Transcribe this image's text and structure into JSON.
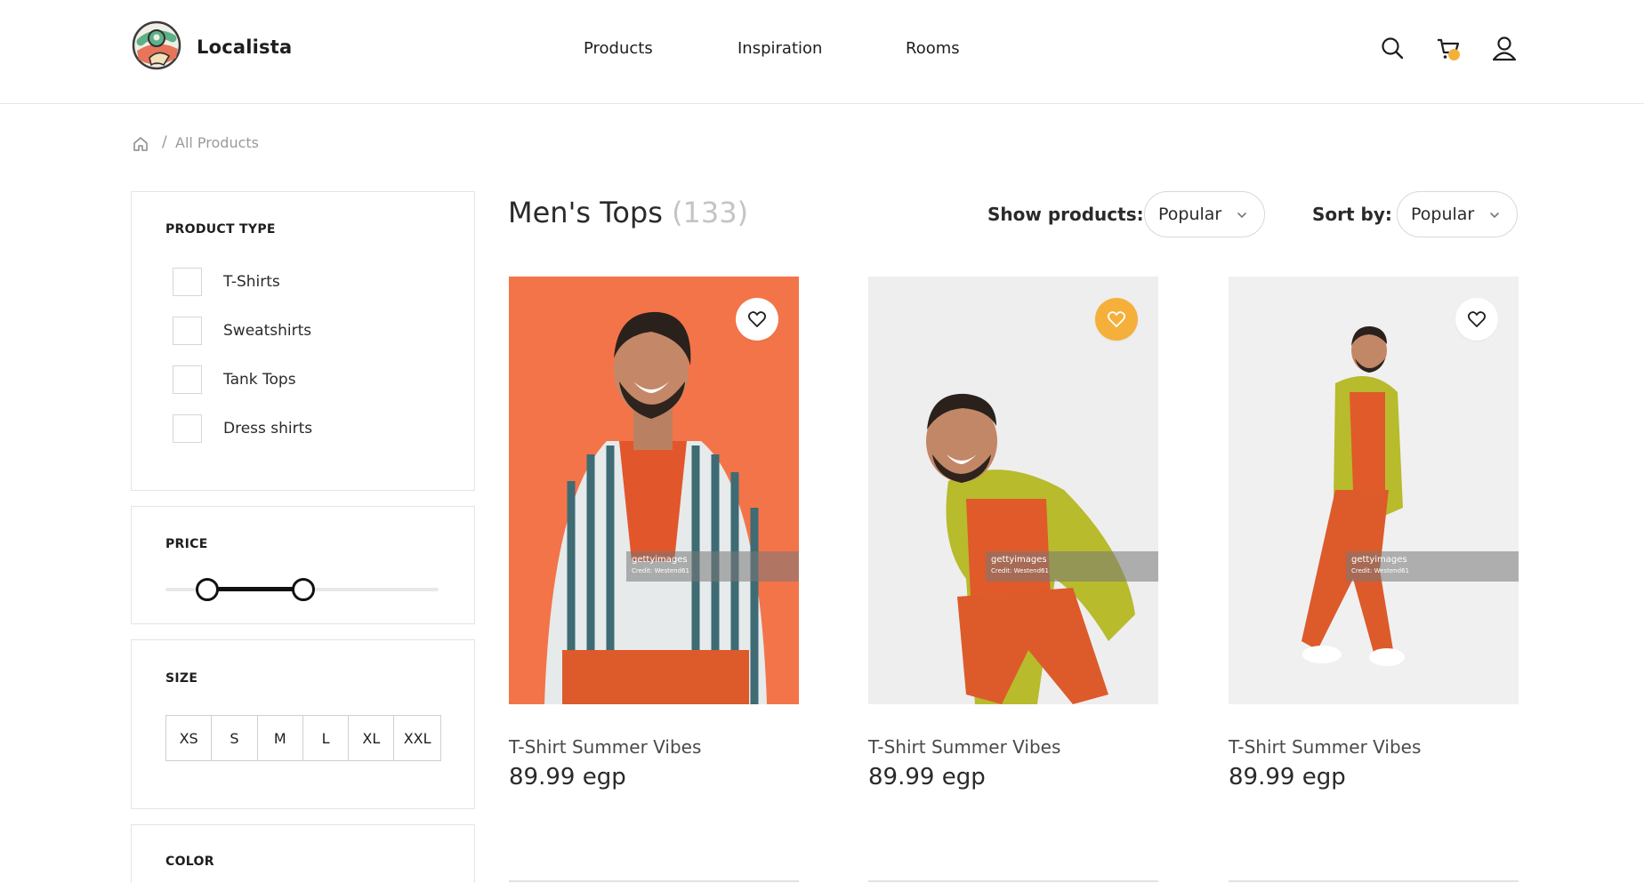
{
  "header": {
    "brand": "Localista",
    "nav": [
      "Products",
      "Inspiration",
      "Rooms"
    ],
    "icons": [
      "search-icon",
      "cart-icon",
      "user-icon"
    ],
    "cart_badge_color": "#f4b13a"
  },
  "breadcrumb": {
    "home_icon": "home-icon",
    "separator": "/",
    "current": "All Products"
  },
  "filters": {
    "product_type": {
      "title": "PRODUCT TYPE",
      "options": [
        "T-Shirts",
        "Sweatshirts",
        "Tank Tops",
        "Dress shirts"
      ]
    },
    "price": {
      "title": "PRICE"
    },
    "size": {
      "title": "SIZE",
      "options": [
        "XS",
        "S",
        "M",
        "L",
        "XL",
        "XXL"
      ]
    },
    "color": {
      "title": "COLOR"
    }
  },
  "main": {
    "title": "Men's Tops",
    "count": "(133)",
    "show_products_label": "Show products:",
    "show_products_value": "Popular",
    "sort_by_label": "Sort by:",
    "sort_by_value": "Popular"
  },
  "products": [
    {
      "name": "T-Shirt Summer Vibes",
      "price": "89.99 egp",
      "favorited": false,
      "bg": "#f4744a"
    },
    {
      "name": "T-Shirt Summer Vibes",
      "price": "89.99 egp",
      "favorited": true,
      "bg": "#eeeeee"
    },
    {
      "name": "T-Shirt Summer Vibes",
      "price": "89.99 egp",
      "favorited": false,
      "bg": "#f0f0f0"
    }
  ],
  "watermark": {
    "brand": "gettyimages",
    "credit": "Credit: Westend61"
  },
  "colors": {
    "accent": "#f5b03b",
    "text": "#2a2a2a",
    "muted": "#9a9a9a"
  }
}
